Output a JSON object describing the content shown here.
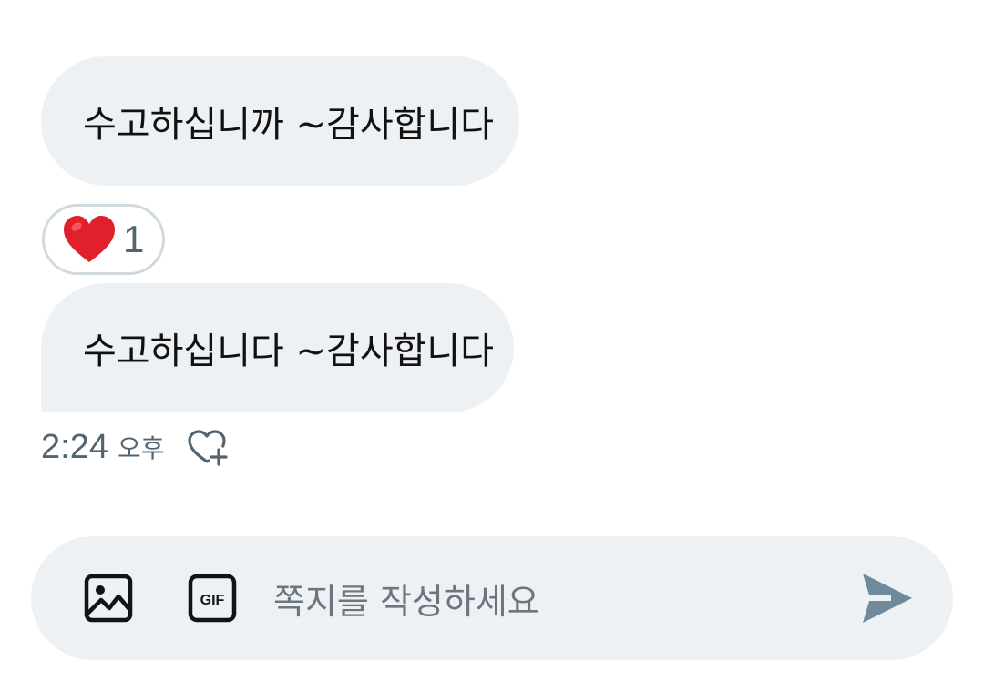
{
  "messages": [
    {
      "text": "수고하십니까 ~감사합니다"
    },
    {
      "text": "수고하십니다 ~감사합니다"
    }
  ],
  "reaction": {
    "icon": "heart-icon",
    "count": "1"
  },
  "last_message_meta": {
    "time": "2:24",
    "ampm": "오후",
    "add_reaction_icon": "heart-plus-icon"
  },
  "composer": {
    "placeholder": "쪽지를 작성하세요",
    "image_icon": "image-icon",
    "gif_icon": "gif-icon",
    "gif_label": "GIF",
    "send_icon": "send-icon"
  },
  "colors": {
    "bubble_bg": "#eef1f4",
    "muted_text": "#536471",
    "heart": "#e0202a",
    "send_icon": "#6e8a9c"
  }
}
